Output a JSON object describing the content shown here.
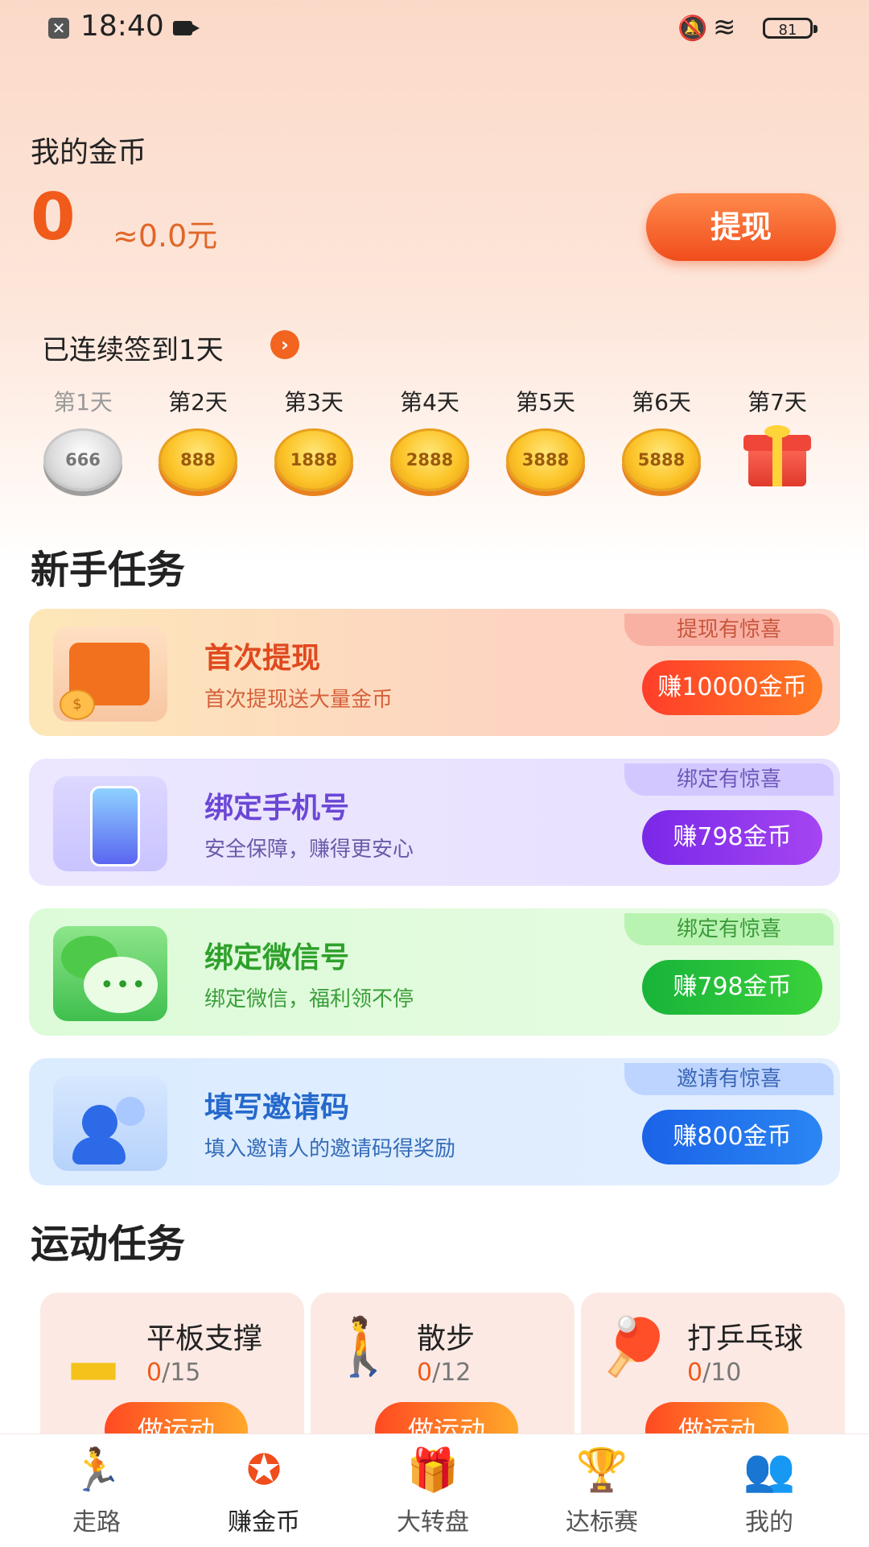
{
  "status_bar": {
    "time": "18:40",
    "battery": "81"
  },
  "coins": {
    "title": "我的金币",
    "value": "0",
    "approx": "≈0.0元",
    "withdraw_label": "提现"
  },
  "signin": {
    "title": "已连续签到1天",
    "days": [
      {
        "label": "第1天",
        "reward": "666"
      },
      {
        "label": "第2天",
        "reward": "888"
      },
      {
        "label": "第3天",
        "reward": "1888"
      },
      {
        "label": "第4天",
        "reward": "2888"
      },
      {
        "label": "第5天",
        "reward": "3888"
      },
      {
        "label": "第6天",
        "reward": "5888"
      },
      {
        "label": "第7天",
        "reward": ""
      }
    ]
  },
  "newbie": {
    "title": "新手任务",
    "tasks": [
      {
        "title": "首次提现",
        "desc": "首次提现送大量金币",
        "tag": "提现有惊喜",
        "reward": "赚10000金币"
      },
      {
        "title": "绑定手机号",
        "desc": "安全保障，赚得更安心",
        "tag": "绑定有惊喜",
        "reward": "赚798金币"
      },
      {
        "title": "绑定微信号",
        "desc": "绑定微信，福利领不停",
        "tag": "绑定有惊喜",
        "reward": "赚798金币"
      },
      {
        "title": "填写邀请码",
        "desc": "填入邀请人的邀请码得奖励",
        "tag": "邀请有惊喜",
        "reward": "赚800金币"
      }
    ]
  },
  "sport": {
    "title": "运动任务",
    "items": [
      {
        "title": "平板支撑",
        "done": "0",
        "total": "/15",
        "button": "做运动"
      },
      {
        "title": "散步",
        "done": "0",
        "total": "/12",
        "button": "做运动"
      },
      {
        "title": "打乒乓球",
        "done": "0",
        "total": "/10",
        "button": "做运动"
      }
    ]
  },
  "nav": {
    "items": [
      {
        "label": "走路",
        "icon": "runner-icon"
      },
      {
        "label": "赚金币",
        "icon": "coin-star-icon"
      },
      {
        "label": "大转盘",
        "icon": "gift-icon"
      },
      {
        "label": "达标赛",
        "icon": "trophy-icon"
      },
      {
        "label": "我的",
        "icon": "user-icon"
      }
    ],
    "active_index": 1
  }
}
